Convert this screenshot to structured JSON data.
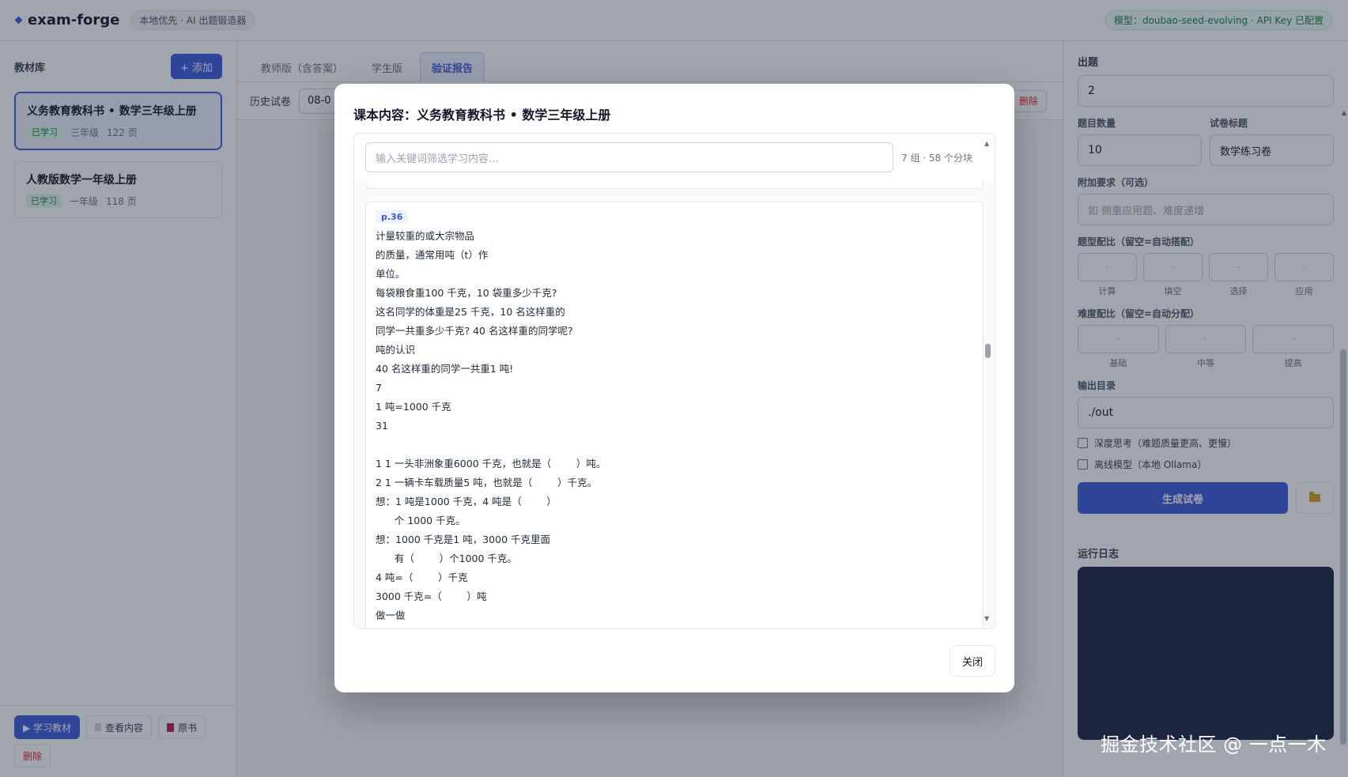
{
  "header": {
    "brand": "exam-forge",
    "tagline": "本地优先 · AI 出题锻造器",
    "model_badge": "模型：doubao-seed-evolving · API Key 已配置"
  },
  "sidebar": {
    "title": "教材库",
    "add_label": "+ 添加",
    "books": [
      {
        "title": "义务教育教科书 • 数学三年级上册",
        "status": "已学习",
        "grade": "三年级",
        "pages": "122 页"
      },
      {
        "title": "人教版数学一年级上册",
        "status": "已学习",
        "grade": "一年级",
        "pages": "118 页"
      }
    ],
    "actions": {
      "study": "▶ 学习教材",
      "view": "查看内容",
      "original": "原书",
      "delete": "删除"
    }
  },
  "main": {
    "tabs": [
      "教师版（含答案）",
      "学生版",
      "验证报告"
    ],
    "active_tab": 2,
    "history_label": "历史试卷",
    "history_value": "08-0",
    "history_delete": "删除"
  },
  "right": {
    "section_title": "出题",
    "first_value": "2",
    "count_label": "题目数量",
    "count_value": "10",
    "paper_title_label": "试卷标题",
    "paper_title_value": "数学练习卷",
    "extra_label": "附加要求（可选）",
    "extra_placeholder": "如 侧重应用题、难度递增",
    "type_ratio_label": "题型配比（留空=自动搭配）",
    "type_ratio_items": [
      "计算",
      "填空",
      "选择",
      "应用"
    ],
    "difficulty_label": "难度配比（留空=自动分配）",
    "difficulty_items": [
      "基础",
      "中等",
      "提高"
    ],
    "output_label": "输出目录",
    "output_value": "./out",
    "deep_think": "深度思考（难题质量更高、更慢）",
    "offline_model": "离线模型（本地 Ollama）",
    "generate_label": "生成试卷",
    "log_title": "运行日志"
  },
  "modal": {
    "title": "课本内容：义务教育教科书 • 数学三年级上册",
    "filter_placeholder": "输入关键词筛选学习内容…",
    "filter_count": "7 组 · 58 个分块",
    "page_tag": "p.36",
    "lines": [
      "计量较重的或大宗物品",
      "的质量，通常用吨（t）作",
      "单位。",
      "每袋粮食重100 千克，10 袋重多少千克?",
      "这名同学的体重是25 千克，10 名这样重的",
      "同学一共重多少千克? 40 名这样重的同学呢?",
      "吨的认识",
      "40 名这样重的同学一共重1 吨!",
      "7",
      "1 吨=1000 千克",
      "31",
      "",
      "1 1 一头非洲象重6000 千克，也就是（        ）吨。",
      "2 1 一辆卡车载质量5 吨，也就是（        ）千克。",
      "想：1 吨是1000 千克，4 吨是（        ）",
      "      个 1000 千克。",
      "想：1000 千克是1 吨，3000 千克里面",
      "      有（        ）个1000 千克。",
      "4 吨=（        ）千克",
      "3000 千克=（        ）吨",
      "做一做"
    ],
    "close_label": "关闭"
  },
  "watermark": "掘金技术社区 @ 一点一木"
}
